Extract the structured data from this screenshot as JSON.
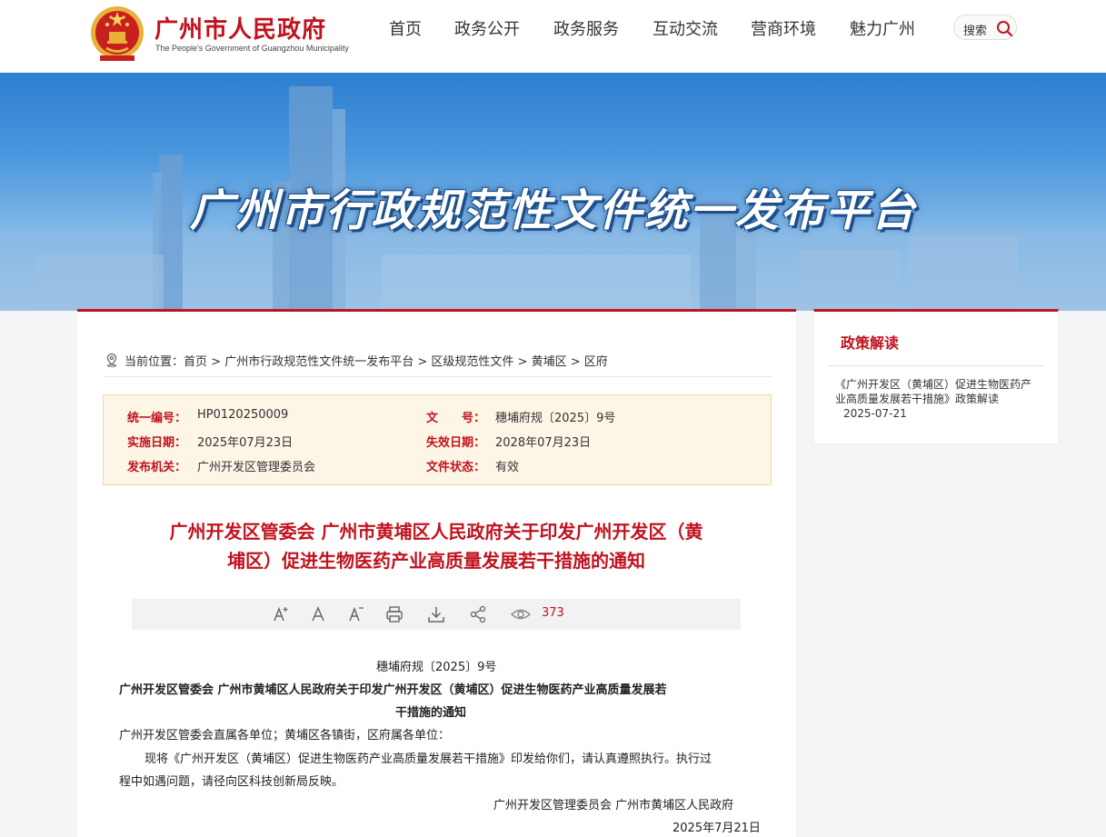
{
  "header": {
    "title": "广州市人民政府",
    "subtitle": "The People's Government of Guangzhou Municipality",
    "nav": [
      "首页",
      "政务公开",
      "政务服务",
      "互动交流",
      "营商环境",
      "魅力广州"
    ],
    "search_label": "搜索"
  },
  "banner": {
    "title": "广州市行政规范性文件统一发布平台"
  },
  "breadcrumb": {
    "prefix": "当前位置：",
    "items": [
      "首页",
      "广州市行政规范性文件统一发布平台",
      "区级规范性文件",
      "黄埔区",
      "区府"
    ],
    "separator": " > "
  },
  "meta": {
    "unified_no_label": "统一编号：",
    "unified_no": "HP0120250009",
    "doc_no_label": "文　　号：",
    "doc_no": "穗埔府规〔2025〕9号",
    "effective_label": "实施日期：",
    "effective": "2025年07月23日",
    "expiry_label": "失效日期：",
    "expiry": "2028年07月23日",
    "issuer_label": "发布机关：",
    "issuer": "广州开发区管理委员会",
    "status_label": "文件状态：",
    "status": "有效"
  },
  "document": {
    "title_line1": "广州开发区管委会 广州市黄埔区人民政府关于印发广州开发区（黄",
    "title_line2": "埔区）促进生物医药产业高质量发展若干措施的通知",
    "views": "373",
    "doc_no": "穗埔府规〔2025〕9号",
    "body_title_line1": "广州开发区管委会  广州市黄埔区人民政府关于印发广州开发区（黄埔区）促进生物医药产业高质量发展若",
    "body_title_line2": "干措施的通知",
    "recipients": "广州开发区管委会直属各单位；黄埔区各镇街，区府属各单位：",
    "para1_line1": "现将《广州开发区（黄埔区）促进生物医药产业高质量发展若干措施》印发给你们，请认真遵照执行。执行过",
    "para1_line2": "程中如遇问题，请径向区科技创新局反映。",
    "signer": "广州开发区管理委员会  广州市黄埔区人民政府",
    "date": "2025年7月21日"
  },
  "sidebar": {
    "title": "政策解读",
    "item_text": "《广州开发区（黄埔区）促进生物医药产业高质量发展若干措施》政策解读",
    "item_date": "2025-07-21"
  },
  "colors": {
    "accent": "#c1121f",
    "meta_bg": "#fdf5e6",
    "banner": "#3b88d6"
  }
}
